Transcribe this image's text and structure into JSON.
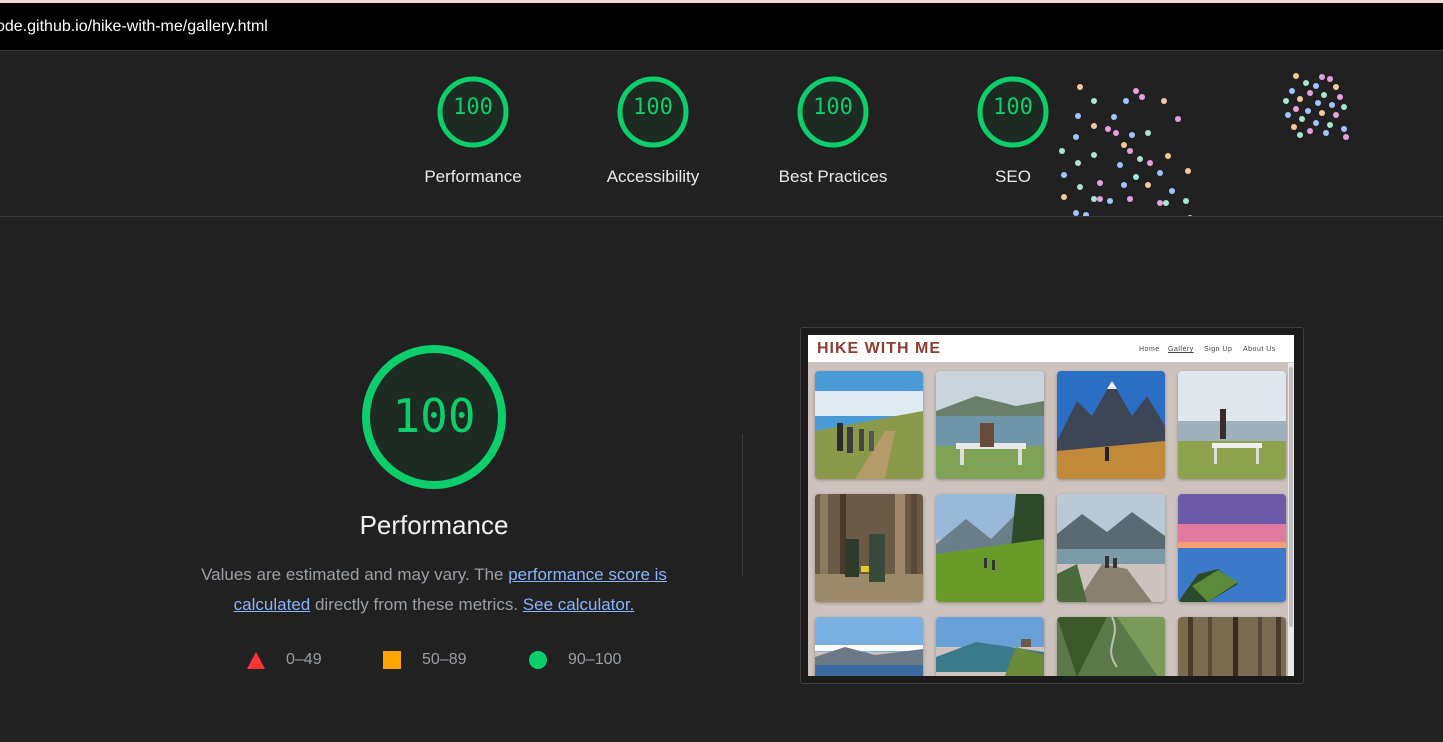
{
  "address_bar": {
    "url": "ode.github.io/hike-with-me/gallery.html"
  },
  "category_scores": [
    {
      "label": "Performance",
      "score": "100"
    },
    {
      "label": "Accessibility",
      "score": "100"
    },
    {
      "label": "Best Practices",
      "score": "100"
    },
    {
      "label": "SEO",
      "score": "100"
    }
  ],
  "main_gauge": {
    "score": "100",
    "title": "Performance",
    "description_start": "Values are estimated and may vary. The ",
    "link_score": "performance score is calculated",
    "description_mid": " directly from these metrics. ",
    "link_calculator": "See calculator."
  },
  "legend": [
    {
      "shape": "triangle-icon",
      "range": "0–49",
      "color": "#ff3333"
    },
    {
      "shape": "square-icon",
      "range": "50–89",
      "color": "#ffa400"
    },
    {
      "shape": "circle-icon",
      "range": "90–100",
      "color": "#0cce6b"
    }
  ],
  "screenshot": {
    "site_title": "HIKE WITH ME",
    "nav": [
      "Home",
      "Gallery",
      "Sign Up",
      "About Us"
    ],
    "active_nav": "Gallery"
  },
  "colors": {
    "pass_green": "#0cce6b",
    "gauge_fill": "#1d2b22",
    "background": "#212121",
    "link": "#8ab4f8",
    "site_title_red": "#8f3d34"
  }
}
